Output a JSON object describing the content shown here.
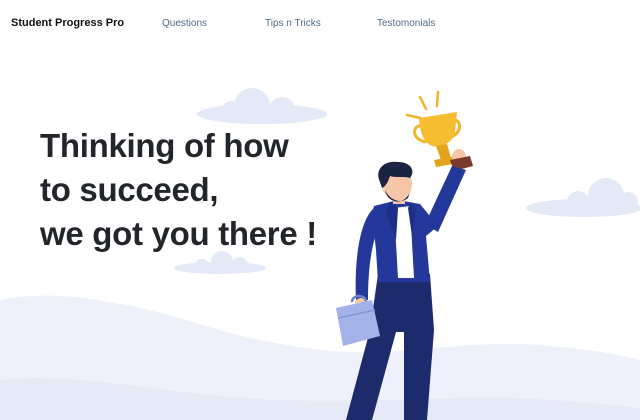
{
  "nav": {
    "brand": "Student Progress Pro",
    "links": [
      {
        "label": "Questions"
      },
      {
        "label": "Tips n Tricks"
      },
      {
        "label": "Testomonials"
      }
    ]
  },
  "hero": {
    "lines": [
      "Thinking of how",
      "to succeed,",
      "we got you there !"
    ]
  },
  "illustration": {
    "icons": [
      "cloud",
      "trophy",
      "briefcase",
      "person"
    ],
    "colors": {
      "cloud": "#e4e9f7",
      "jacket": "#23389a",
      "trousers": "#1d2a6b",
      "trophy": "#f0b429",
      "briefcase": "#9fb0e8",
      "hair": "#1b2440",
      "skin": "#f6c6a8"
    }
  }
}
